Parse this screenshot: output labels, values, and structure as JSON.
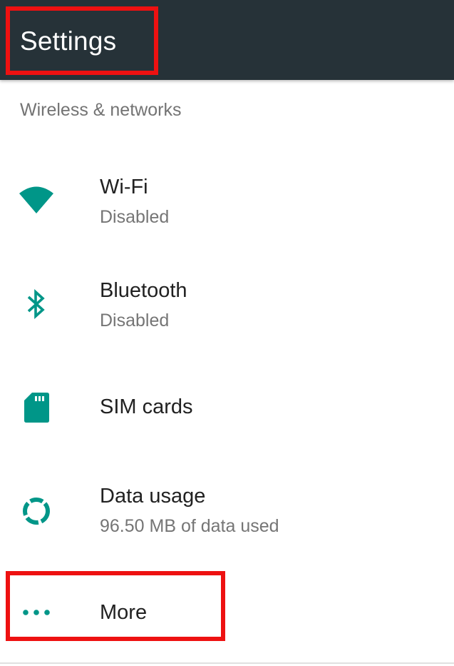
{
  "appbar": {
    "title": "Settings",
    "color": "#263238"
  },
  "accent_color": "#009688",
  "highlight_color": "#ee1111",
  "section": {
    "header": "Wireless & networks"
  },
  "items": [
    {
      "title": "Wi-Fi",
      "summary": "Disabled",
      "icon": "wifi-icon"
    },
    {
      "title": "Bluetooth",
      "summary": "Disabled",
      "icon": "bluetooth-icon"
    },
    {
      "title": "SIM cards",
      "icon": "sim-card-icon"
    },
    {
      "title": "Data usage",
      "summary": "96.50 MB of data used",
      "icon": "data-usage-icon"
    },
    {
      "title": "More",
      "icon": "more-dots-icon"
    }
  ]
}
